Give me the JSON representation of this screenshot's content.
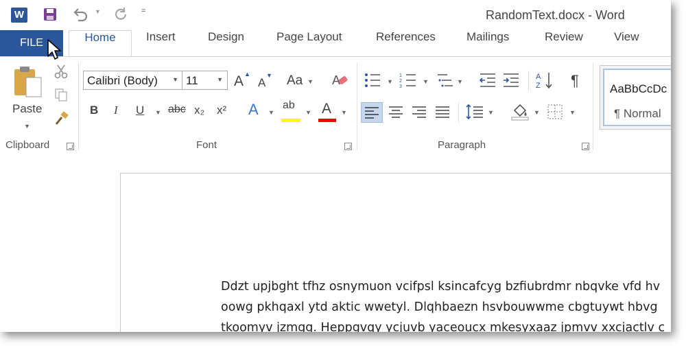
{
  "window": {
    "title": "RandomText.docx - Word"
  },
  "app_icon": {
    "letter": "W",
    "icon": "word-logo-icon",
    "color": "#2b579a"
  },
  "quick_access": {
    "more_label": "="
  },
  "tabs": [
    {
      "label": "FILE"
    },
    {
      "label": "Home"
    },
    {
      "label": "Insert"
    },
    {
      "label": "Design"
    },
    {
      "label": "Page Layout"
    },
    {
      "label": "References"
    },
    {
      "label": "Mailings"
    },
    {
      "label": "Review"
    },
    {
      "label": "View"
    }
  ],
  "ribbon": {
    "clipboard": {
      "label": "Clipboard",
      "paste_label": "Paste"
    },
    "font": {
      "label": "Font",
      "font_name": "Calibri (Body)",
      "font_size": "11",
      "change_case": "Aa",
      "bold": "B",
      "italic": "I",
      "underline": "U",
      "strikethrough": "abc",
      "subscript": "x₂",
      "superscript": "x²",
      "text_effects": "A",
      "highlight": "ab",
      "font_color": "A",
      "grow": "A",
      "shrink": "A",
      "highlight_color": "#ffff00",
      "font_color_swatch": "#ff0000"
    },
    "paragraph": {
      "label": "Paragraph",
      "pilcrow": "¶",
      "sort": "AZ"
    },
    "styles": {
      "preview": "AaBbCcDc",
      "name": "¶ Normal"
    }
  },
  "document": {
    "lines": [
      "Ddzt upjbght tfhz osnymuon vcifpsl ksincafcyg bzfiubrdmr nbqvke vfd hv",
      "oowg pkhqaxl ytd aktic wwetyl. Dlqhbaezn hsvbouwwme cbgtuywt hbvg",
      "tkoomyv jzmgg. Heppgvqy ycjuvb yaceoucx mkesyxaaz jpmvv xxcjactlv c"
    ]
  }
}
